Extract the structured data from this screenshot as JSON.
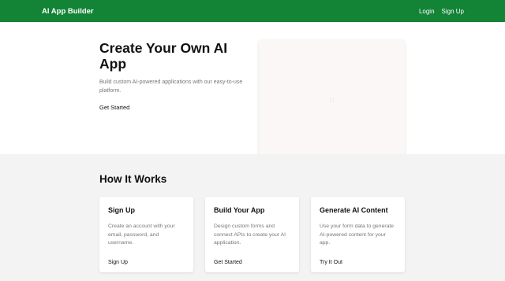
{
  "navbar": {
    "brand": "AI App Builder",
    "login_label": "Login",
    "signup_label": "Sign Up",
    "bg_color": "#138336"
  },
  "hero": {
    "title": "Create Your Own AI App",
    "description": "Build custom AI-powered applications with our easy-to-use platform.",
    "cta_label": "Get Started",
    "image_glyph": "⬚"
  },
  "how_it_works": {
    "title": "How It Works",
    "cards": [
      {
        "title": "Sign Up",
        "description": "Create an account with your email, password, and username.",
        "link": "Sign Up"
      },
      {
        "title": "Build Your App",
        "description": "Design custom forms and connect APIs to create your AI application.",
        "link": "Get Started"
      },
      {
        "title": "Generate AI Content",
        "description": "Use your form data to generate AI-powered content for your app.",
        "link": "Try It Out"
      }
    ]
  }
}
